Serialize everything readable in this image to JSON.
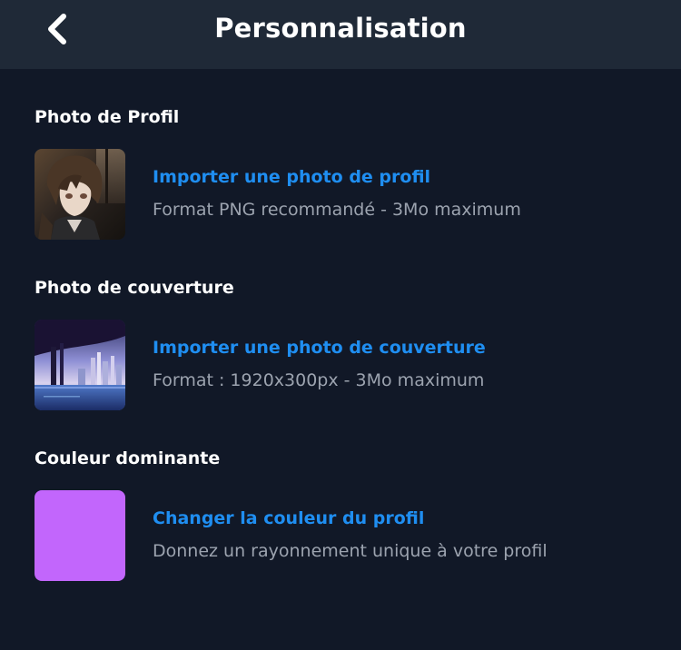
{
  "header": {
    "title": "Personnalisation",
    "back_icon": "chevron-left-icon"
  },
  "sections": {
    "profile_photo": {
      "title": "Photo de Profil",
      "action": "Importer une photo de profil",
      "description": "Format PNG recommandé - 3Mo maximum"
    },
    "cover_photo": {
      "title": "Photo de couverture",
      "action": "Importer une photo de couverture",
      "description": "Format : 1920x300px - 3Mo maximum"
    },
    "dominant_color": {
      "title": "Couleur dominante",
      "action": "Changer la couleur du profil",
      "description": "Donnez un rayonnement unique à votre profil",
      "color": "#c266fc"
    }
  },
  "colors": {
    "background": "#111827",
    "header": "#1f2937",
    "accent": "#1f8ef1",
    "muted_text": "#9ca3af"
  }
}
